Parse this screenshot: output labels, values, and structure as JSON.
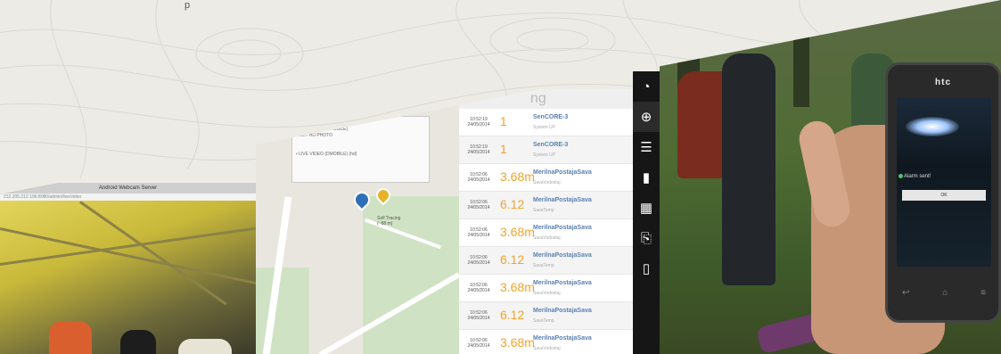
{
  "background": {
    "color": "#ecebe6"
  },
  "webcam": {
    "title": "Android Webcam Server",
    "url": "212.205.212.196:8080/admin/live/video"
  },
  "map": {
    "popup_lines": [
      "Commands",
      "• LIVE VIDEO (DMOBILE)",
      "• GET HD PHOTO",
      "• LIVE VIDEO (DMOBILE) (hd)"
    ],
    "marker_label_1": "Self Tracing",
    "marker_label_2": "(~88 m)"
  },
  "events": {
    "header_fragment": "ng",
    "rows": [
      {
        "time": "10:52:19",
        "date": "24/05/2014",
        "value": "1",
        "name": "SenCORE-3",
        "sub": "System UP"
      },
      {
        "time": "10:52:19",
        "date": "24/05/2014",
        "value": "1",
        "name": "SenCORE-3",
        "sub": "System UP"
      },
      {
        "time": "10:52:06",
        "date": "24/05/2014",
        "value": "3.68m",
        "name": "MerilnaPostajaSava",
        "sub": "SavaVodostaj"
      },
      {
        "time": "10:52:06",
        "date": "24/05/2014",
        "value": "6.12",
        "name": "MerilnaPostajaSava",
        "sub": "SavaTemp"
      },
      {
        "time": "10:52:06",
        "date": "24/05/2014",
        "value": "3.68m",
        "name": "MerilnaPostajaSava",
        "sub": "SavaVodostaj"
      },
      {
        "time": "10:52:06",
        "date": "24/05/2014",
        "value": "6.12",
        "name": "MerilnaPostajaSava",
        "sub": "SavaTemp"
      },
      {
        "time": "10:52:06",
        "date": "24/05/2014",
        "value": "3.68m",
        "name": "MerilnaPostajaSava",
        "sub": "SavaVodostaj"
      },
      {
        "time": "10:52:06",
        "date": "24/05/2014",
        "value": "6.12",
        "name": "MerilnaPostajaSava",
        "sub": "SavaTemp"
      },
      {
        "time": "10:52:06",
        "date": "24/05/2014",
        "value": "3.68m",
        "name": "MerilnaPostajaSava",
        "sub": "SavaVodostaj"
      }
    ]
  },
  "toolbar": {
    "items": [
      {
        "icon": "gauge-icon",
        "glyph": "◔"
      },
      {
        "icon": "globe-icon",
        "glyph": "⊕"
      },
      {
        "icon": "list-icon",
        "glyph": "☰"
      },
      {
        "icon": "bar-chart-icon",
        "glyph": "▮"
      },
      {
        "icon": "calendar-icon",
        "glyph": "▦"
      },
      {
        "icon": "paperclip-icon",
        "glyph": "⎘"
      },
      {
        "icon": "mobile-icon",
        "glyph": "▯"
      }
    ]
  },
  "phone": {
    "brand": "htc",
    "alarm_text": "Alarm sent!",
    "ok_label": "OK"
  },
  "top_fragment": "p"
}
